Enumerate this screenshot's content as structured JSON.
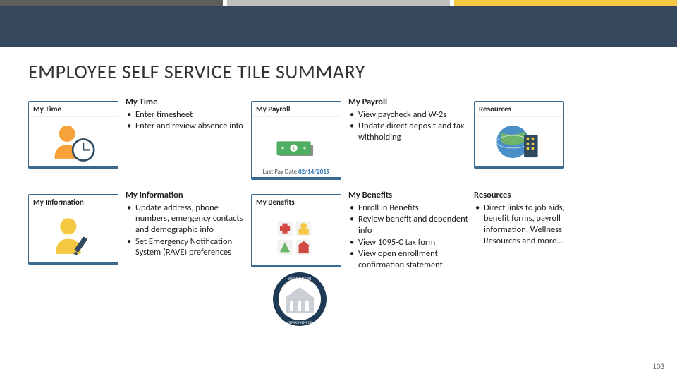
{
  "slide_title": "EMPLOYEE SELF SERVICE TILE SUMMARY",
  "page_number": "103",
  "row1": {
    "tileA": {
      "header": "My Time"
    },
    "descA": {
      "title": "My Time",
      "items": [
        "Enter timesheet",
        "Enter and review absence info"
      ]
    },
    "tileB": {
      "header": "My Payroll",
      "footer_label": "Last Pay Date",
      "footer_value": "02/14/2019"
    },
    "descB": {
      "title": "My Payroll",
      "items": [
        "View paycheck and W-2s",
        "Update direct deposit and tax withholding"
      ]
    },
    "tileC": {
      "header": "Resources"
    }
  },
  "row2": {
    "tileA": {
      "header": "My Information"
    },
    "descA": {
      "title": "My Information",
      "items": [
        "Update address, phone numbers, emergency contacts and demographic info",
        "Set Emergency Notification System (RAVE) preferences"
      ]
    },
    "tileB": {
      "header": "My Benefits"
    },
    "descB": {
      "title": "My Benefits",
      "items": [
        "Enroll in Benefits",
        "Review benefit and dependent info",
        "View 1095-C tax form",
        "View open enrollment confirmation statement"
      ]
    },
    "descC": {
      "title": "Resources",
      "items": [
        "Direct links to job aids, benefit forms, payroll information, Wellness Resources and more…"
      ]
    }
  }
}
